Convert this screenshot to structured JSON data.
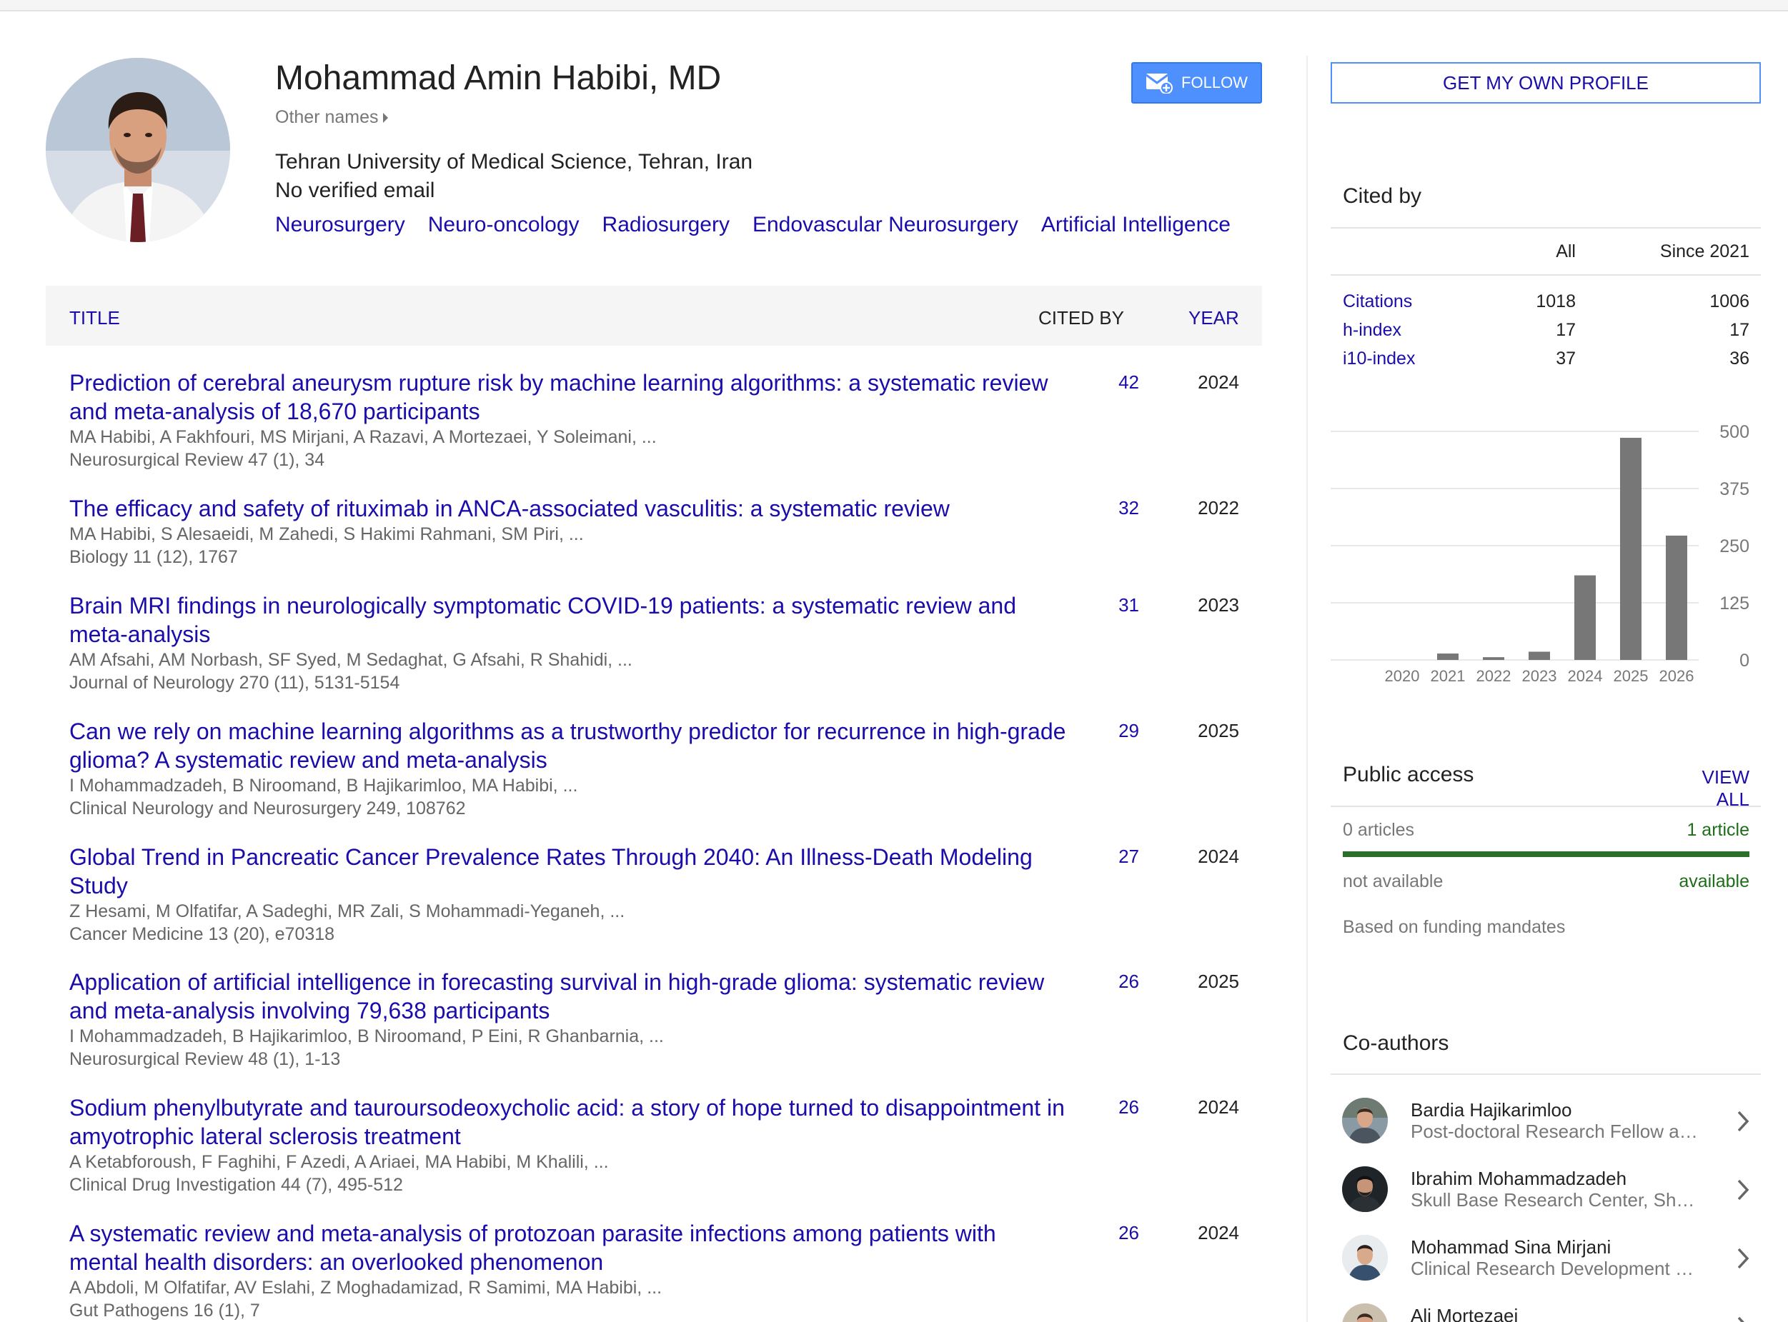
{
  "profile": {
    "name": "Mohammad Amin Habibi, MD",
    "other_names": "Other names",
    "affiliation": "Tehran University of Medical Science, Tehran, Iran",
    "email": "No verified email",
    "interests": [
      "Neurosurgery",
      "Neuro-oncology",
      "Radiosurgery",
      "Endovascular Neurosurgery",
      "Artificial Intelligence"
    ],
    "follow_label": "FOLLOW"
  },
  "table": {
    "headers": {
      "title": "TITLE",
      "cited_by": "CITED BY",
      "year": "YEAR"
    },
    "rows": [
      {
        "title": "Prediction of cerebral aneurysm rupture risk by machine learning algorithms: a systematic review and meta-analysis of 18,670 participants",
        "authors": "MA Habibi, A Fakhfouri, MS Mirjani, A Razavi, A Mortezaei, Y Soleimani, ...",
        "venue": "Neurosurgical Review 47 (1), 34",
        "cited": "42",
        "year": "2024"
      },
      {
        "title": "The efficacy and safety of rituximab in ANCA-associated vasculitis: a systematic review",
        "authors": "MA Habibi, S Alesaeidi, M Zahedi, S Hakimi Rahmani, SM Piri, ...",
        "venue": "Biology 11 (12), 1767",
        "cited": "32",
        "year": "2022"
      },
      {
        "title": "Brain MRI findings in neurologically symptomatic COVID-19 patients: a systematic review and meta-analysis",
        "authors": "AM Afsahi, AM Norbash, SF Syed, M Sedaghat, G Afsahi, R Shahidi, ...",
        "venue": "Journal of Neurology 270 (11), 5131-5154",
        "cited": "31",
        "year": "2023"
      },
      {
        "title": "Can we rely on machine learning algorithms as a trustworthy predictor for recurrence in high-grade glioma? A systematic review and meta-analysis",
        "authors": "I Mohammadzadeh, B Niroomand, B Hajikarimloo, MA Habibi, ...",
        "venue": "Clinical Neurology and Neurosurgery 249, 108762",
        "cited": "29",
        "year": "2025"
      },
      {
        "title": "Global Trend in Pancreatic Cancer Prevalence Rates Through 2040: An Illness-Death Modeling Study",
        "authors": "Z Hesami, M Olfatifar, A Sadeghi, MR Zali, S Mohammadi-Yeganeh, ...",
        "venue": "Cancer Medicine 13 (20), e70318",
        "cited": "27",
        "year": "2024"
      },
      {
        "title": "Application of artificial intelligence in forecasting survival in high-grade glioma: systematic review and meta-analysis involving 79,638 participants",
        "authors": "I Mohammadzadeh, B Hajikarimloo, B Niroomand, P Eini, R Ghanbarnia, ...",
        "venue": "Neurosurgical Review 48 (1), 1-13",
        "cited": "26",
        "year": "2025"
      },
      {
        "title": "Sodium phenylbutyrate and tauroursodeoxycholic acid: a story of hope turned to disappointment in amyotrophic lateral sclerosis treatment",
        "authors": "A Ketabforoush, F Faghihi, F Azedi, A Ariaei, MA Habibi, M Khalili, ...",
        "venue": "Clinical Drug Investigation 44 (7), 495-512",
        "cited": "26",
        "year": "2024"
      },
      {
        "title": "A systematic review and meta-analysis of protozoan parasite infections among patients with mental health disorders: an overlooked phenomenon",
        "authors": "A Abdoli, M Olfatifar, AV Eslahi, Z Moghadamizad, R Samimi, MA Habibi, ...",
        "venue": "Gut Pathogens 16 (1), 7",
        "cited": "26",
        "year": "2024"
      }
    ]
  },
  "sidebar": {
    "own_profile": "GET MY OWN PROFILE",
    "cited_by": {
      "heading": "Cited by",
      "col_all": "All",
      "col_since": "Since 2021",
      "stats": [
        {
          "label": "Citations",
          "all": "1018",
          "since": "1006"
        },
        {
          "label": "h-index",
          "all": "17",
          "since": "17"
        },
        {
          "label": "i10-index",
          "all": "37",
          "since": "36"
        }
      ]
    },
    "public_access": {
      "heading": "Public access",
      "view_all": "VIEW ALL",
      "left_count": "0 articles",
      "right_count": "1 article",
      "left_label": "not available",
      "right_label": "available",
      "note": "Based on funding mandates"
    },
    "coauthors": {
      "heading": "Co-authors",
      "items": [
        {
          "name": "Bardia Hajikarimloo",
          "affiliation": "Post-doctoral Research Fellow at University of Virginia"
        },
        {
          "name": "Ibrahim Mohammadzadeh",
          "affiliation": "Skull Base Research Center, Shahid Beheshti University"
        },
        {
          "name": "Mohammad Sina Mirjani",
          "affiliation": "Clinical Research Development Center"
        },
        {
          "name": "Ali Mortezaei",
          "affiliation": ""
        }
      ]
    }
  },
  "chart_data": {
    "type": "bar",
    "categories": [
      "2020",
      "2021",
      "2022",
      "2023",
      "2024",
      "2025",
      "2026"
    ],
    "values": [
      0,
      14,
      6,
      18,
      185,
      486,
      272
    ],
    "ylim": [
      0,
      500
    ],
    "yticks": [
      "0",
      "125",
      "250",
      "375",
      "500"
    ],
    "grid": true,
    "bar_color": "#777777"
  },
  "colors": {
    "link": "#1a0dab",
    "follow": "#4d90fe",
    "available": "#1e6e1a"
  }
}
